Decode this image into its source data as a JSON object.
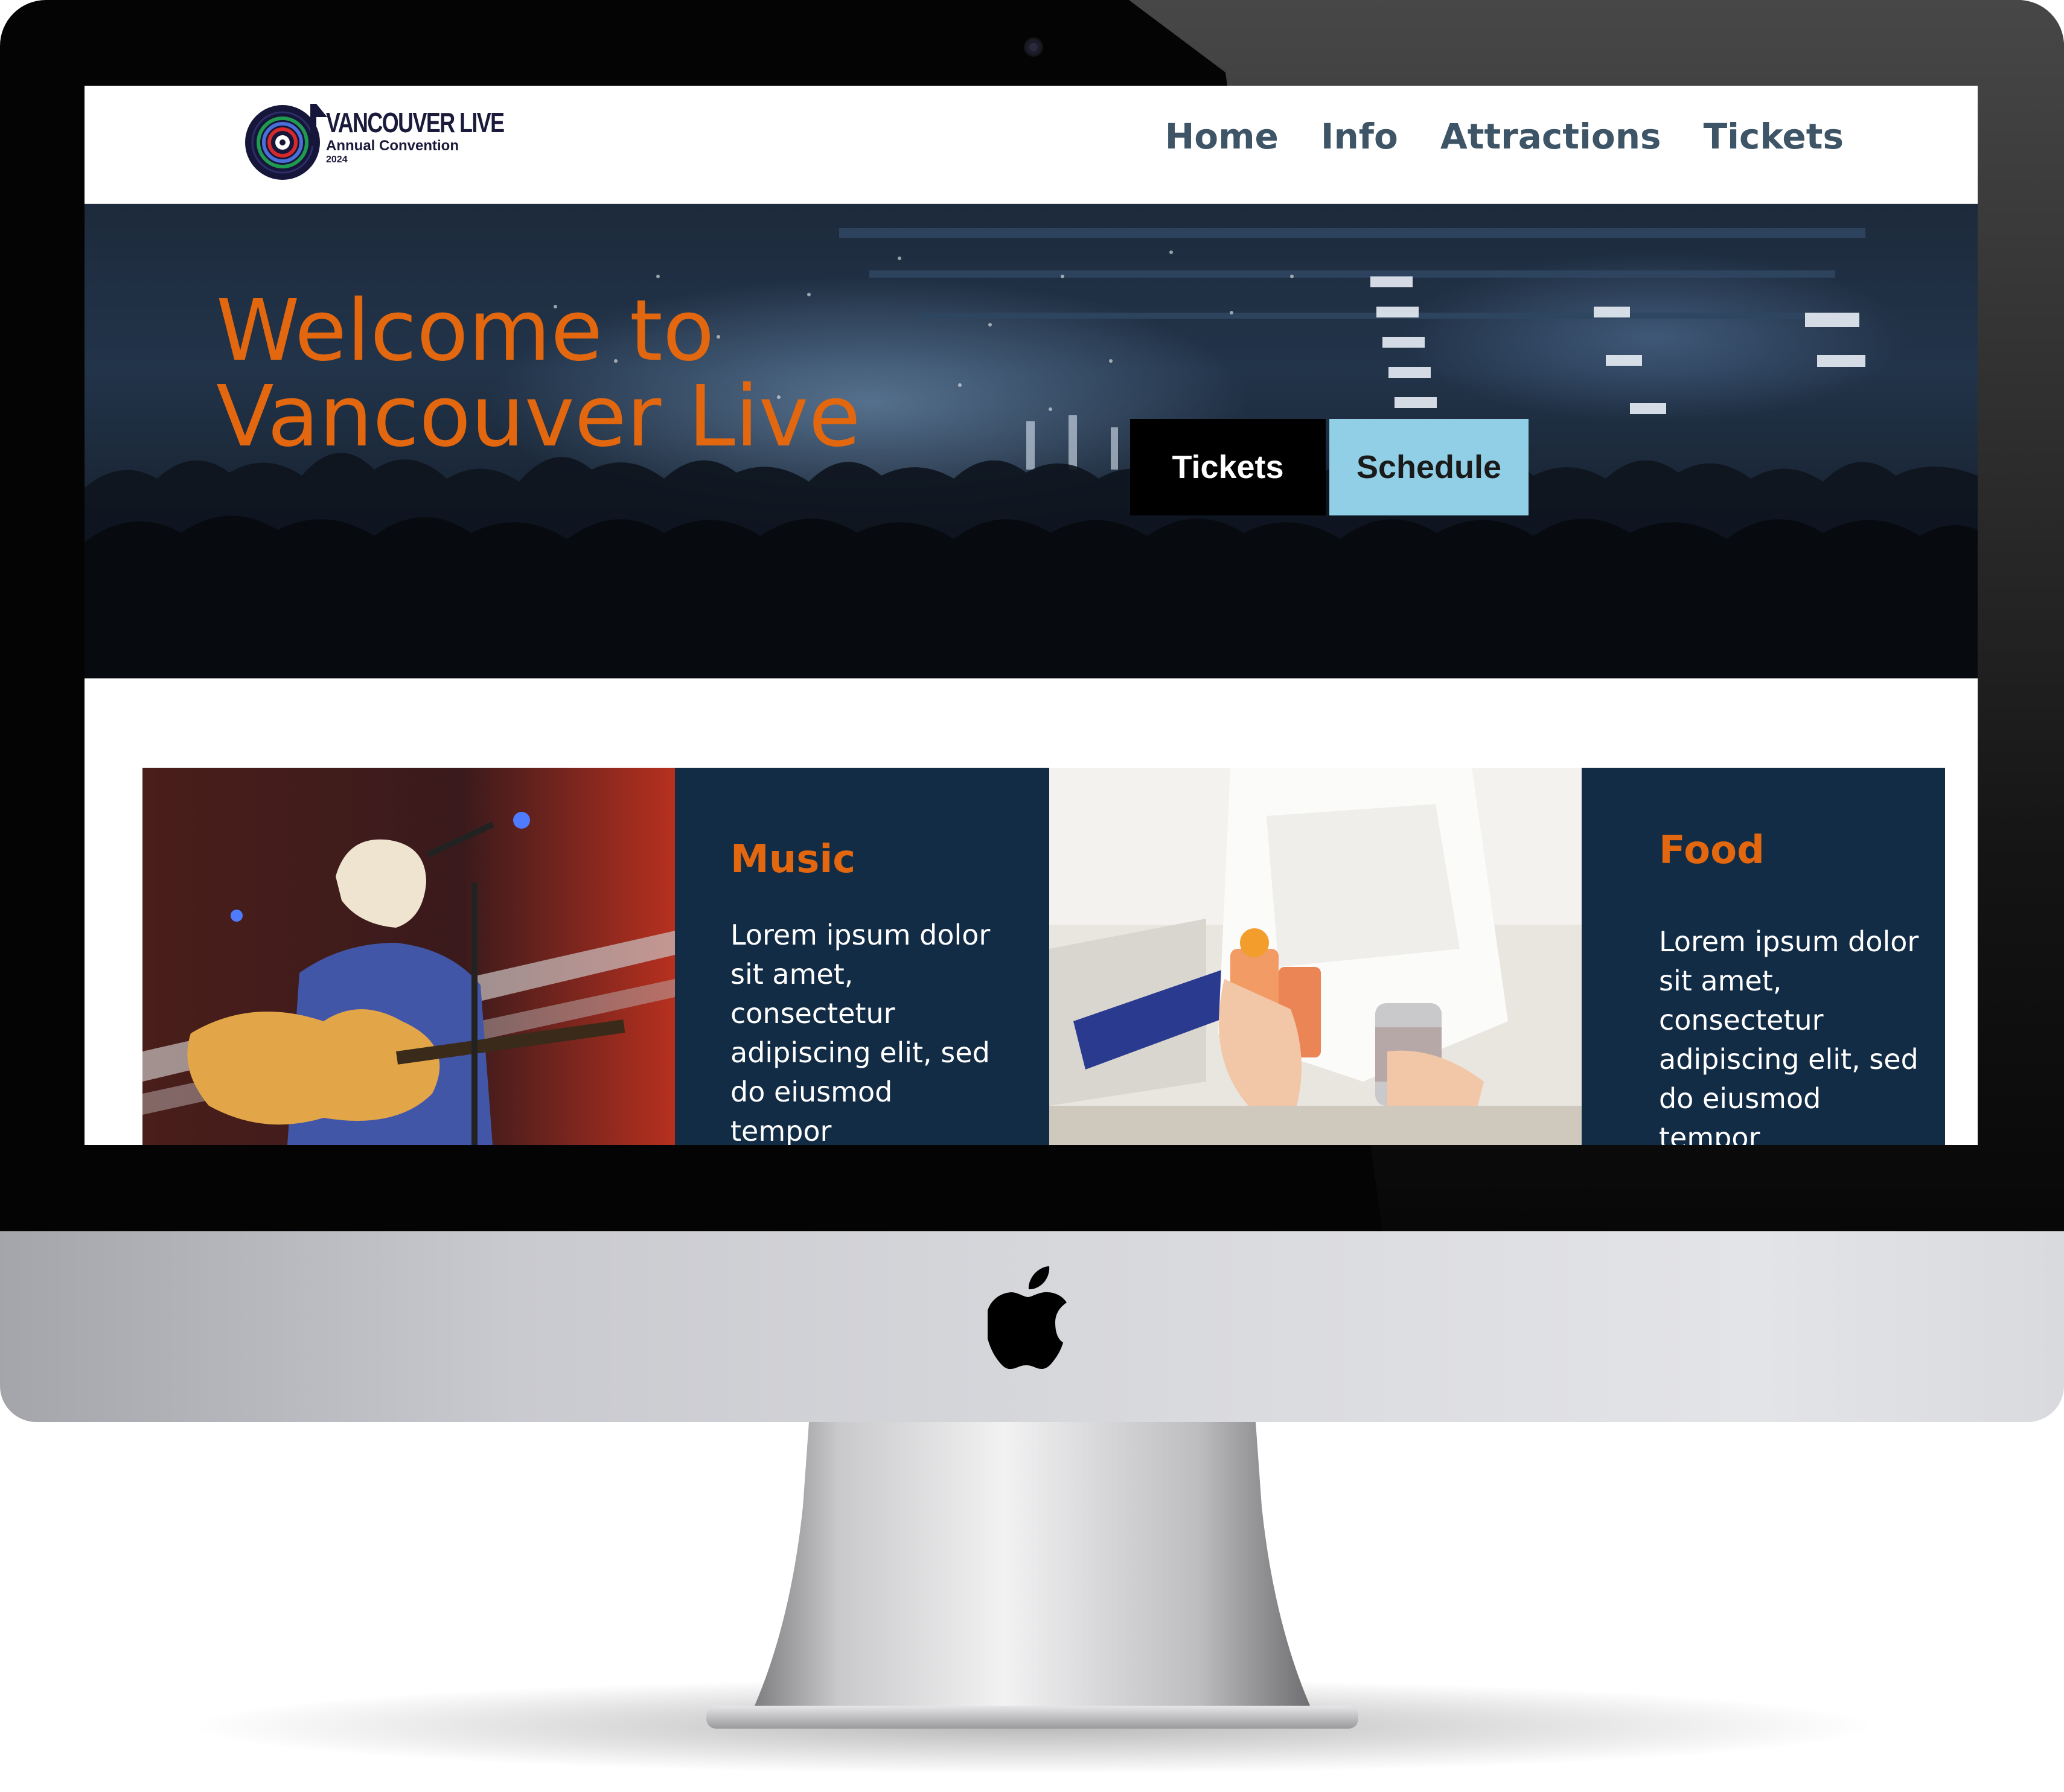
{
  "nav": {
    "logo": {
      "title": "VANCOUVER LIVE",
      "subtitle": "Annual Convention",
      "year": "2024"
    },
    "links": [
      "Home",
      "Info",
      "Attractions",
      "Tickets"
    ]
  },
  "hero": {
    "title_line1": "Welcome to",
    "title_line2": "Vancouver Live",
    "buttons": {
      "tickets": "Tickets",
      "schedule": "Schedule"
    }
  },
  "cards": [
    {
      "heading": "Music",
      "body": "Lorem ipsum dolor sit amet, consectetur adipiscing elit, sed do eiusmod tempor"
    },
    {
      "heading": "Food",
      "body": "Lorem ipsum dolor sit amet, consectetur adipiscing elit, sed do eiusmod tempor"
    }
  ],
  "colors": {
    "accent_orange": "#e2670e",
    "nav_text": "#3d5566",
    "card_navy": "#132c45",
    "schedule_button": "#90cfe6",
    "tickets_button": "#000000"
  },
  "icons": {
    "device_logo": "apple-icon",
    "brand_logo": "vinyl-record-icon"
  }
}
